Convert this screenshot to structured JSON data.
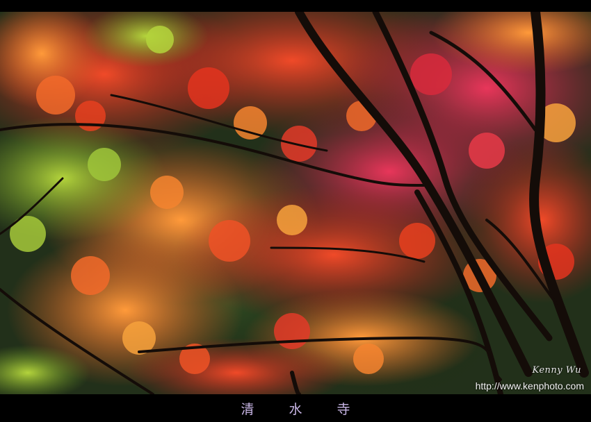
{
  "photo": {
    "subject": "autumn maple leaves on dark branches",
    "palette": [
      "#d8301e",
      "#f06a2a",
      "#f7a23c",
      "#e0304a",
      "#9fc63a",
      "#2a3a1e",
      "#140c08"
    ]
  },
  "watermark": {
    "signature": "Kenny Wu",
    "url": "http://www.kenphoto.com"
  },
  "caption": "清 水 寺"
}
